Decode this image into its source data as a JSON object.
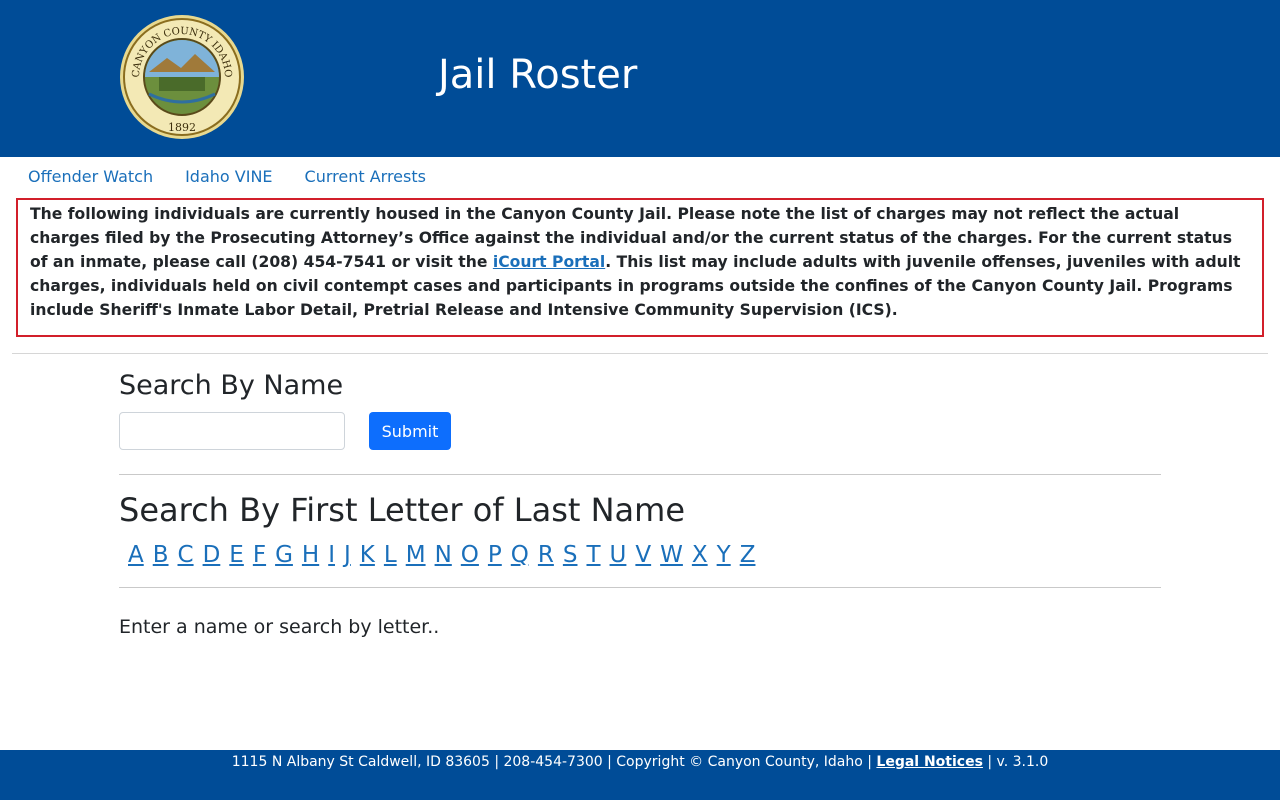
{
  "header": {
    "title": "Jail Roster",
    "seal": {
      "top_text": "CANYON COUNTY IDAHO",
      "year": "1892",
      "icon": "county-seal"
    }
  },
  "nav": {
    "items": [
      {
        "label": "Offender Watch"
      },
      {
        "label": "Idaho VINE"
      },
      {
        "label": "Current Arrests"
      }
    ]
  },
  "notice": {
    "text_before_link": "The following individuals are currently housed in the Canyon County Jail. Please note the list of charges may not reflect the actual charges filed by the Prosecuting Attorney’s Office against the individual and/or the current status of the charges. For the current status of an inmate, please call (208) 454-7541 or visit the ",
    "link_label": "iCourt Portal",
    "text_after_link": ". This list may include adults with juvenile offenses, juveniles with adult charges, individuals held on civil contempt cases and participants in programs outside the confines of the Canyon County Jail. Programs include Sheriff's Inmate Labor Detail, Pretrial Release and Intensive Community Supervision (ICS)."
  },
  "search_name": {
    "heading": "Search By Name",
    "input_value": "",
    "submit_label": "Submit"
  },
  "search_letter": {
    "heading": "Search By First Letter of Last Name",
    "letters": [
      "A",
      "B",
      "C",
      "D",
      "E",
      "F",
      "G",
      "H",
      "I",
      "J",
      "K",
      "L",
      "M",
      "N",
      "O",
      "P",
      "Q",
      "R",
      "S",
      "T",
      "U",
      "V",
      "W",
      "X",
      "Y",
      "Z"
    ]
  },
  "results": {
    "hint": "Enter a name or search by letter.."
  },
  "footer": {
    "text": "1115 N Albany St Caldwell, ID 83605 | 208-454-7300 | Copyright © Canyon County, Idaho | ",
    "legal_label": "Legal Notices",
    "version": " | v. 3.1.0"
  },
  "colors": {
    "brand_blue": "#004c97",
    "link_blue": "#1a6fba",
    "button_blue": "#0d6efd",
    "notice_border": "#d21f2a"
  }
}
